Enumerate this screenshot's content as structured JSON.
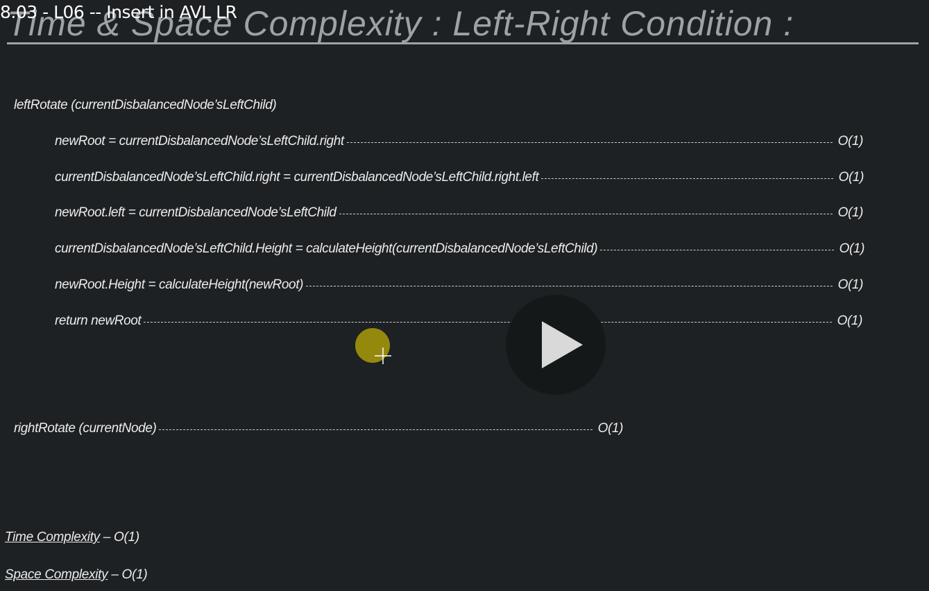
{
  "video": {
    "title": "8.03 - L06 -- Insert in AVL LR"
  },
  "slide": {
    "title": "Time & Space Complexity : Left-Right Condition :",
    "function_header": "leftRotate (currentDisbalancedNode’sLeftChild)",
    "lines": [
      {
        "code": "newRoot = currentDisbalancedNode’sLeftChild.right",
        "complexity": "O(1)"
      },
      {
        "code": "currentDisbalancedNode’sLeftChild.right = currentDisbalancedNode’sLeftChild.right.left",
        "complexity": "O(1)"
      },
      {
        "code": "newRoot.left = currentDisbalancedNode’sLeftChild",
        "complexity": "O(1)"
      },
      {
        "code": "currentDisbalancedNode’sLeftChild.Height = calculateHeight(currentDisbalancedNode’sLeftChild)",
        "complexity": "O(1)"
      },
      {
        "code": "newRoot.Height = calculateHeight(newRoot)",
        "complexity": "O(1)"
      },
      {
        "code": "return newRoot",
        "complexity": "O(1)"
      }
    ],
    "right_rotate": {
      "code": "rightRotate (currentNode)",
      "complexity": "O(1)"
    },
    "time_complexity": {
      "label": "Time Complexity",
      "value": "– O(1)"
    },
    "space_complexity": {
      "label": "Space Complexity",
      "value": "– O(1)"
    }
  },
  "player": {
    "play_icon": "play-icon",
    "cursor_color": "#9c8f0d",
    "background": "#1e2123"
  }
}
